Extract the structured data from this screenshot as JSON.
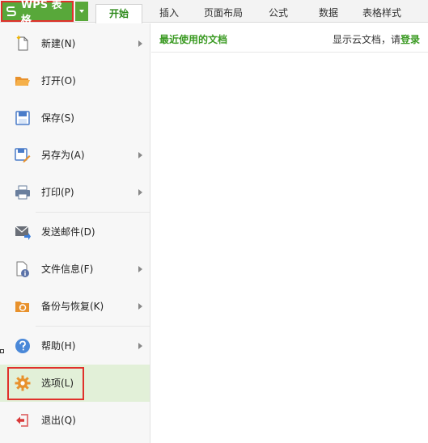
{
  "app": {
    "button_label": "WPS 表格",
    "accent": "#58a83a",
    "highlight": "#e0312b"
  },
  "tabs": [
    {
      "label": "开始",
      "active": true
    },
    {
      "label": "插入"
    },
    {
      "label": "页面布局"
    },
    {
      "label": "公式"
    },
    {
      "label": "数据"
    },
    {
      "label": "表格样式"
    }
  ],
  "menu": {
    "items": [
      {
        "label": "新建(N)",
        "icon": "new-document-icon",
        "submenu": true
      },
      {
        "label": "打开(O)",
        "icon": "open-folder-icon"
      },
      {
        "label": "保存(S)",
        "icon": "save-icon"
      },
      {
        "label": "另存为(A)",
        "icon": "save-as-icon",
        "submenu": true
      },
      {
        "label": "打印(P)",
        "icon": "printer-icon",
        "submenu": true
      },
      {
        "label": "发送邮件(D)",
        "icon": "mail-icon"
      },
      {
        "label": "文件信息(F)",
        "icon": "file-info-icon",
        "submenu": true
      },
      {
        "label": "备份与恢复(K)",
        "icon": "backup-icon",
        "submenu": true
      },
      {
        "label": "帮助(H)",
        "icon": "help-icon",
        "submenu": true
      },
      {
        "label": "选项(L)",
        "icon": "gear-icon",
        "selected": true
      },
      {
        "label": "退出(Q)",
        "icon": "exit-icon"
      }
    ]
  },
  "panel": {
    "recent_title": "最近使用的文档",
    "cloud_text": "显示云文档，请",
    "login_link": "登录"
  }
}
